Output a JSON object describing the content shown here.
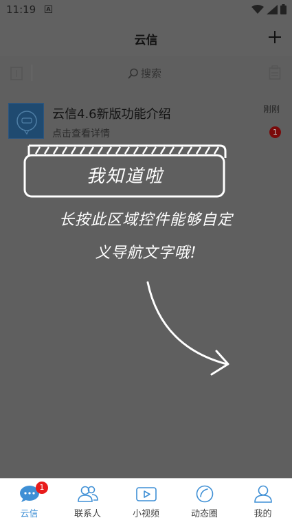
{
  "status_bar": {
    "time": "11:19",
    "notification_icon": "a-icon",
    "indicators": [
      "wifi-icon",
      "signal-icon",
      "battery-icon"
    ]
  },
  "header": {
    "title": "云信",
    "action_icon": "plus-icon"
  },
  "search": {
    "label": "搜索",
    "left_icon": "file-icon",
    "right_icon": "clipboard-icon"
  },
  "conversation": {
    "title": "云信4.6新版功能介绍",
    "subtitle": "点击查看详情",
    "time": "刚刚",
    "unread": "1",
    "avatar_icon": "chat-bubble-icon"
  },
  "guide": {
    "button_label": "我知道啦",
    "line1": "长按此区域控件能够自定",
    "line2": "义导航文字哦!",
    "arrow_icon": "curved-arrow-icon"
  },
  "bottom_nav": {
    "items": [
      {
        "label": "云信",
        "icon": "chat-icon",
        "badge": "1",
        "active": true
      },
      {
        "label": "联系人",
        "icon": "contacts-icon"
      },
      {
        "label": "小视频",
        "icon": "video-icon"
      },
      {
        "label": "动态圈",
        "icon": "moments-icon"
      },
      {
        "label": "我的",
        "icon": "profile-icon"
      }
    ]
  },
  "colors": {
    "overlay": "#5f5f5f",
    "accent": "#3e8fd5",
    "badge": "#e81b1b",
    "avatar_bg": "#1f4a70"
  }
}
